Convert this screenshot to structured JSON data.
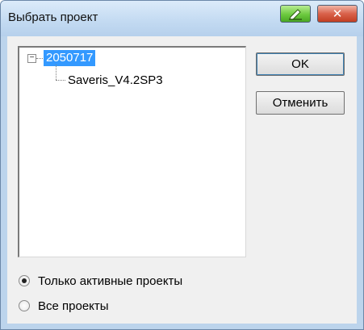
{
  "window": {
    "title": "Выбрать проект"
  },
  "titlebar_buttons": {
    "help_icon": "pen-icon",
    "close_label": "✕"
  },
  "tree": {
    "expander": "−",
    "root_label": "2050717",
    "child_label": "Saveris_V4.2SP3"
  },
  "buttons": {
    "ok_label": "OK",
    "cancel_label": "Отменить"
  },
  "filter": {
    "options": [
      {
        "label": "Только активные проекты",
        "checked": true
      },
      {
        "label": "Все проекты",
        "checked": false
      }
    ]
  },
  "colors": {
    "selection": "#3399ff",
    "titlebar": "#c4dbf2",
    "close_button": "#c23e23"
  }
}
